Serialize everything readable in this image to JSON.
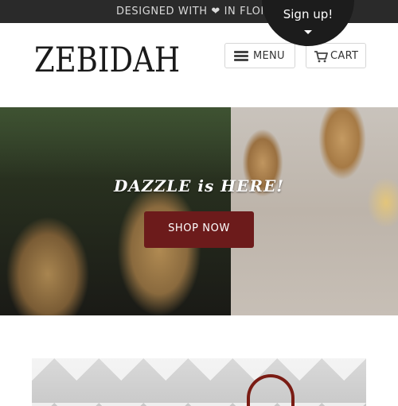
{
  "announcement": {
    "text": "DESIGNED WITH ❤ IN FLOR"
  },
  "signup": {
    "label": "Sign up!"
  },
  "header": {
    "logo": "ZEBIDAH",
    "menu_label": "MENU",
    "cart_label": "CART"
  },
  "hero": {
    "title": "DAZZLE is HERE!",
    "cta_label": "SHOP NOW"
  },
  "colors": {
    "announce_bar": "#2a2a2a",
    "cta_button": "#6c1b1b",
    "signup_bubble": "#1c1c1c"
  },
  "icons": [
    "hamburger-icon",
    "cart-icon",
    "caret-down-icon"
  ]
}
